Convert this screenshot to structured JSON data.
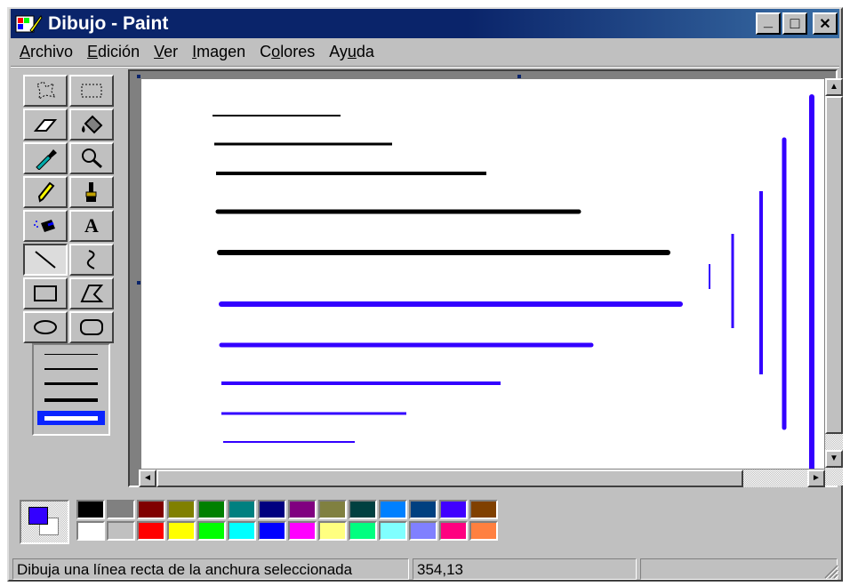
{
  "window": {
    "title": "Dibujo - Paint",
    "buttons": {
      "minimize": "_",
      "maximize": "□",
      "close": "✕"
    }
  },
  "menu": [
    {
      "key": "A",
      "rest": "rchivo"
    },
    {
      "key": "E",
      "rest": "dición"
    },
    {
      "key": "V",
      "rest": "er"
    },
    {
      "key": "I",
      "rest": "magen"
    },
    {
      "pre": "C",
      "key": "o",
      "rest": "lores"
    },
    {
      "pre": "Ay",
      "key": "u",
      "rest": "da"
    }
  ],
  "tools": [
    {
      "name": "free-select-icon",
      "pressed": false
    },
    {
      "name": "rect-select-icon",
      "pressed": false
    },
    {
      "name": "eraser-icon",
      "pressed": false
    },
    {
      "name": "fill-bucket-icon",
      "pressed": false
    },
    {
      "name": "color-picker-icon",
      "pressed": false
    },
    {
      "name": "magnifier-icon",
      "pressed": false
    },
    {
      "name": "pencil-icon",
      "pressed": false
    },
    {
      "name": "brush-icon",
      "pressed": false
    },
    {
      "name": "airbrush-icon",
      "pressed": false
    },
    {
      "name": "text-icon",
      "pressed": false,
      "glyph": "A"
    },
    {
      "name": "line-icon",
      "pressed": true
    },
    {
      "name": "curve-icon",
      "pressed": false
    },
    {
      "name": "rectangle-icon",
      "pressed": false
    },
    {
      "name": "polygon-icon",
      "pressed": false
    },
    {
      "name": "ellipse-icon",
      "pressed": false
    },
    {
      "name": "rounded-rect-icon",
      "pressed": false
    }
  ],
  "line_widths": {
    "options": [
      1,
      2,
      3,
      4,
      5
    ],
    "selected": 5
  },
  "colors": {
    "foreground": "#3300ff",
    "background": "#ffffff",
    "black_line": "#000000",
    "blue_line": "#3300ff"
  },
  "palette": {
    "top": [
      "#000000",
      "#808080",
      "#800000",
      "#808000",
      "#008000",
      "#008080",
      "#000080",
      "#800080",
      "#808040",
      "#004040",
      "#0080ff",
      "#004080",
      "#4000ff",
      "#804000"
    ],
    "bottom": [
      "#ffffff",
      "#c0c0c0",
      "#ff0000",
      "#ffff00",
      "#00ff00",
      "#00ffff",
      "#0000ff",
      "#ff00ff",
      "#ffff80",
      "#00ff80",
      "#80ffff",
      "#8080ff",
      "#ff0080",
      "#ff8040"
    ]
  },
  "status": {
    "help_text": "Dibuja una línea recta de la anchura seleccionada",
    "coords": "354,13",
    "size": ""
  }
}
